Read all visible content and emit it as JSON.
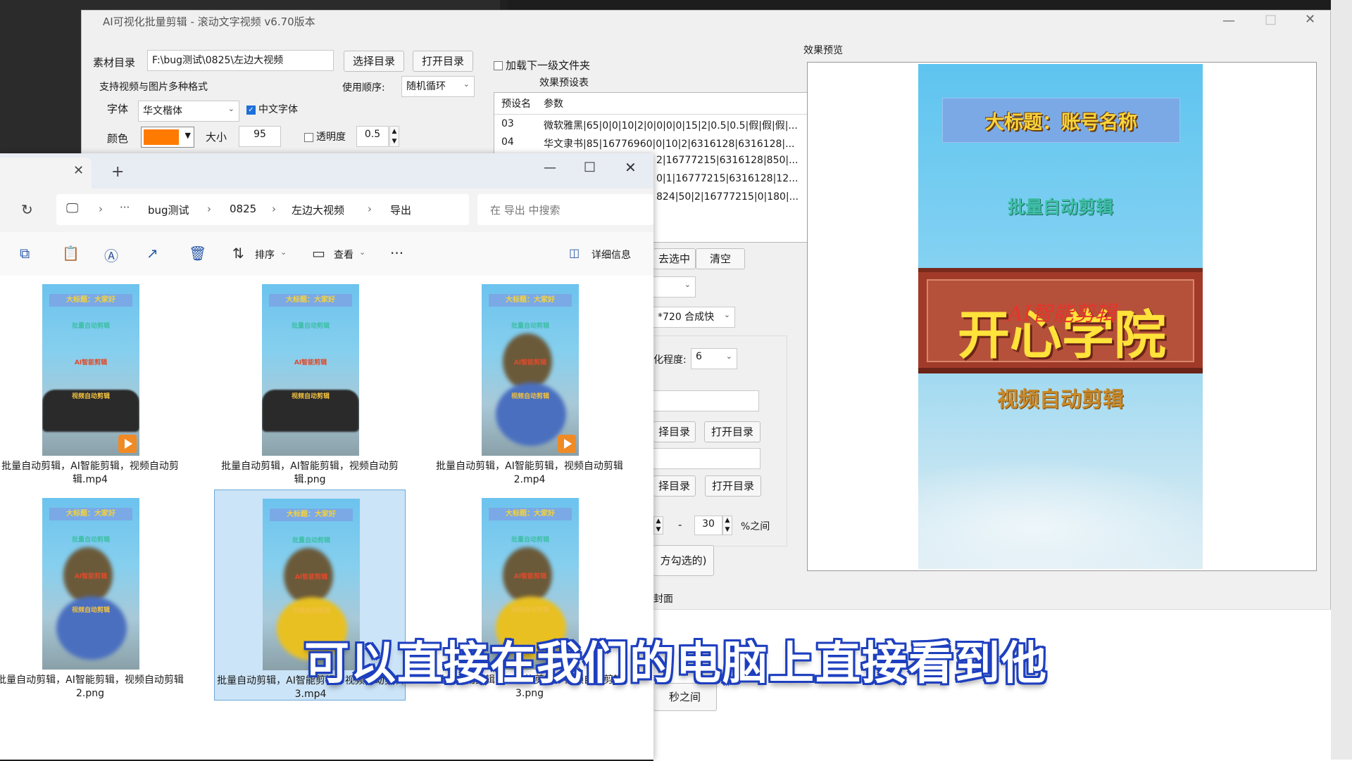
{
  "app": {
    "title": "AI可视化批量剪辑 - 滚动文字视频  v6.70版本",
    "material_dir_label": "素材目录",
    "material_dir_value": "F:\\bug测试\\0825\\左边大视频",
    "choose_dir": "选择目录",
    "open_dir": "打开目录",
    "load_subfolder": "加载下一级文件夹",
    "formats_note": "支持视频与图片多种格式",
    "order_label": "使用顺序:",
    "order_value": "随机循环",
    "font_label": "字体",
    "font_value": "华文楷体",
    "chinese_font": "中文字体",
    "color_label": "颜色",
    "color_value": "#ff7a00",
    "size_label": "大小",
    "size_value": "95",
    "opacity_label": "透明度",
    "opacity_value": "0.5",
    "preset_title": "效果预设表",
    "preset_headers": [
      "预设名",
      "参数"
    ],
    "presets": [
      {
        "name": "03",
        "params": "微软雅黑|65|0|0|10|2|0|0|0|0|15|2|0.5|0.5|假|假|假|..."
      },
      {
        "name": "04",
        "params": "华文隶书|85|16776960|0|10|2|6316128|6316128|..."
      },
      {
        "name": "",
        "params": "2|16777215|6316128|850|..."
      },
      {
        "name": "",
        "params": "0|1|16777215|6316128|12..."
      },
      {
        "name": "",
        "params": "824|50|2|16777215|0|180|..."
      }
    ],
    "delete_selected": "去选中",
    "clear": "清空",
    "resolution_value": "*720 合成快",
    "blur_label": "化程度:",
    "blur_value": "6",
    "choose_dir_2": "择目录",
    "open_dir_2": "打开目录",
    "choose_dir_3": "择目录",
    "open_dir_3": "打开目录",
    "range_dash": "-",
    "range_value": "30",
    "range_unit": "%之间",
    "checked_note": "方勾选的)",
    "cover_tab": "封面",
    "seconds_between": "秒之间",
    "preview_title": "效果预览",
    "preview": {
      "headline": "大标题：账号名称",
      "line1": "批量自动剪辑",
      "sign_big": "开心学院",
      "sign_small": "AI智能剪辑",
      "line2": "视频自动剪辑"
    }
  },
  "explorer": {
    "path": [
      "bug测试",
      "0825",
      "左边大视频",
      "导出"
    ],
    "more": "···",
    "search_placeholder": "在 导出 中搜索",
    "sort": "排序",
    "view": "查看",
    "details": "详细信息",
    "files": [
      {
        "name": "批量自动剪辑，AI智能剪辑，视频自动剪辑.mp4",
        "video": true,
        "selected": false
      },
      {
        "name": "批量自动剪辑，AI智能剪辑，视频自动剪辑.png",
        "video": false,
        "selected": false
      },
      {
        "name": "批量自动剪辑，AI智能剪辑，视频自动剪辑2.mp4",
        "video": true,
        "selected": false
      },
      {
        "name": "批量自动剪辑，AI智能剪辑，视频自动剪辑2.png",
        "video": false,
        "selected": false
      },
      {
        "name": "批量自动剪辑，AI智能剪辑，视频自动剪辑3.mp4",
        "video": false,
        "selected": true
      },
      {
        "name": "批量自动剪辑，AI智能剪辑，视频自动剪辑3.png",
        "video": false,
        "selected": false
      }
    ],
    "thumb_headline": "大标题：大家好",
    "thumb_lines": [
      "批量自动剪辑",
      "AI智能剪辑",
      "视频自动剪辑"
    ]
  },
  "caption": "可以直接在我们的电脑上直接看到他"
}
